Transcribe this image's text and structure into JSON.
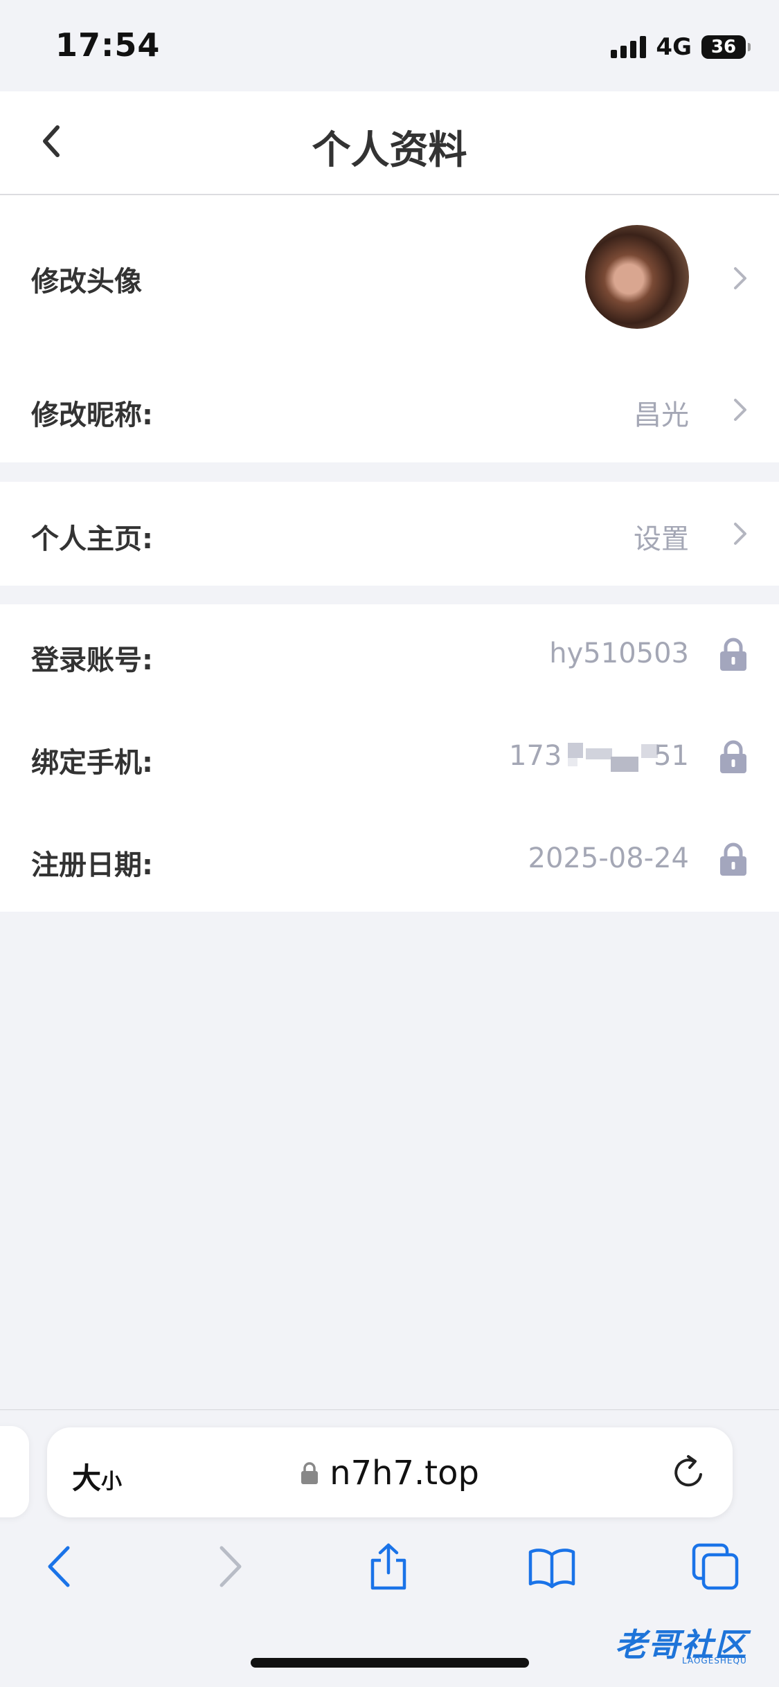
{
  "status_bar": {
    "time": "17:54",
    "network": "4G",
    "battery": "36"
  },
  "header": {
    "title": "个人资料"
  },
  "profile": {
    "avatar_label": "修改头像",
    "nickname_label": "修改昵称:",
    "nickname_value": "昌光",
    "homepage_label": "个人主页:",
    "homepage_value": "设置",
    "account_label": "登录账号:",
    "account_value": "hy510503",
    "phone_label": "绑定手机:",
    "phone_prefix": "173",
    "phone_suffix": "51",
    "register_label": "注册日期:",
    "register_value": "2025-08-24"
  },
  "browser": {
    "text_size_big": "大",
    "text_size_small": "小",
    "url": "n7h7.top"
  },
  "watermark": {
    "title": "老哥社区",
    "subtitle": "LAOGESHEQU"
  },
  "colors": {
    "accent": "#1e74d9",
    "muted_text": "#a4a7b5",
    "lock": "#a3a6bd"
  }
}
